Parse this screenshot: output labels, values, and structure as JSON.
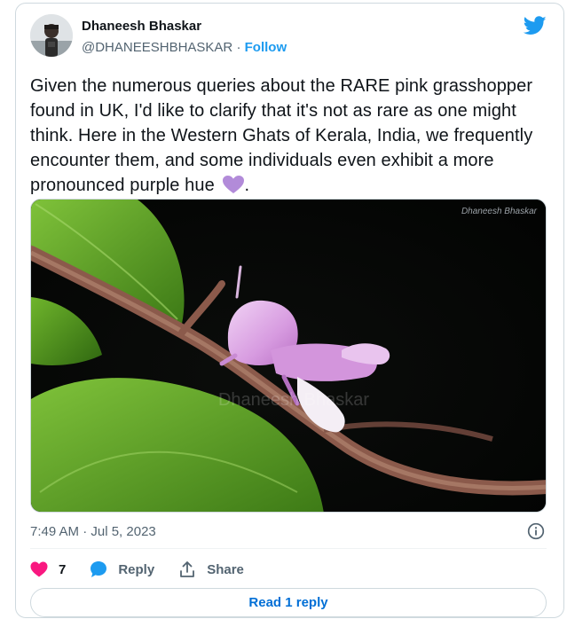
{
  "author": {
    "name": "Dhaneesh Bhaskar",
    "handle": "@DHANEESHBHASKAR",
    "separator": "·",
    "follow_label": "Follow",
    "avatar_icon": "profile-photo-icon"
  },
  "brand_icon": "twitter-bird-icon",
  "tweet": {
    "text": "Given the numerous queries about the RARE pink grasshopper found in UK, I'd like to clarify that it's not as rare as one might think. Here in the Western Ghats of Kerala, India, we frequently encounter them, and some individuals even exhibit a more pronounced purple hue",
    "text_suffix": ".",
    "emoji": "purple-heart-icon"
  },
  "media": {
    "watermark_corner": "Dhaneesh Bhaskar",
    "watermark_center": "Dhaneesh Bhaskar",
    "subject": "pink grasshopper on stem"
  },
  "timestamp": "7:49 AM · Jul 5, 2023",
  "actions": {
    "like_count": "7",
    "reply_label": "Reply",
    "share_label": "Share"
  },
  "read_replies_label": "Read 1 reply",
  "colors": {
    "accent": "#1d9bf0",
    "like": "#f91880",
    "purple_heart": "#b28bd9",
    "link": "#006fd6"
  }
}
